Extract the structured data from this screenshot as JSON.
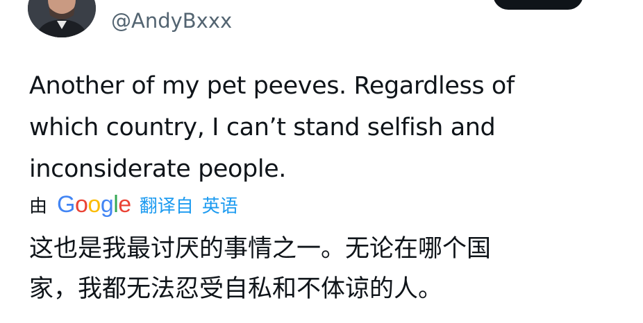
{
  "author": {
    "handle": "@AndyBxxx"
  },
  "tweet": {
    "text": "Another of my pet peeves. Regardless of\nwhich country, I can’t stand selfish and\ninconsiderate people."
  },
  "translation": {
    "by_label": "由",
    "provider_logo": "Google",
    "translated_from_label": "翻译自",
    "source_language": "英语",
    "text": "这也是我最讨厌的事情之一。无论在哪个国\n家，我都无法忍受自私和不体谅的人。"
  },
  "colors": {
    "text": "#0f1419",
    "secondary_text": "#536471",
    "link": "#1d9bf0",
    "button": "#0f1419"
  }
}
